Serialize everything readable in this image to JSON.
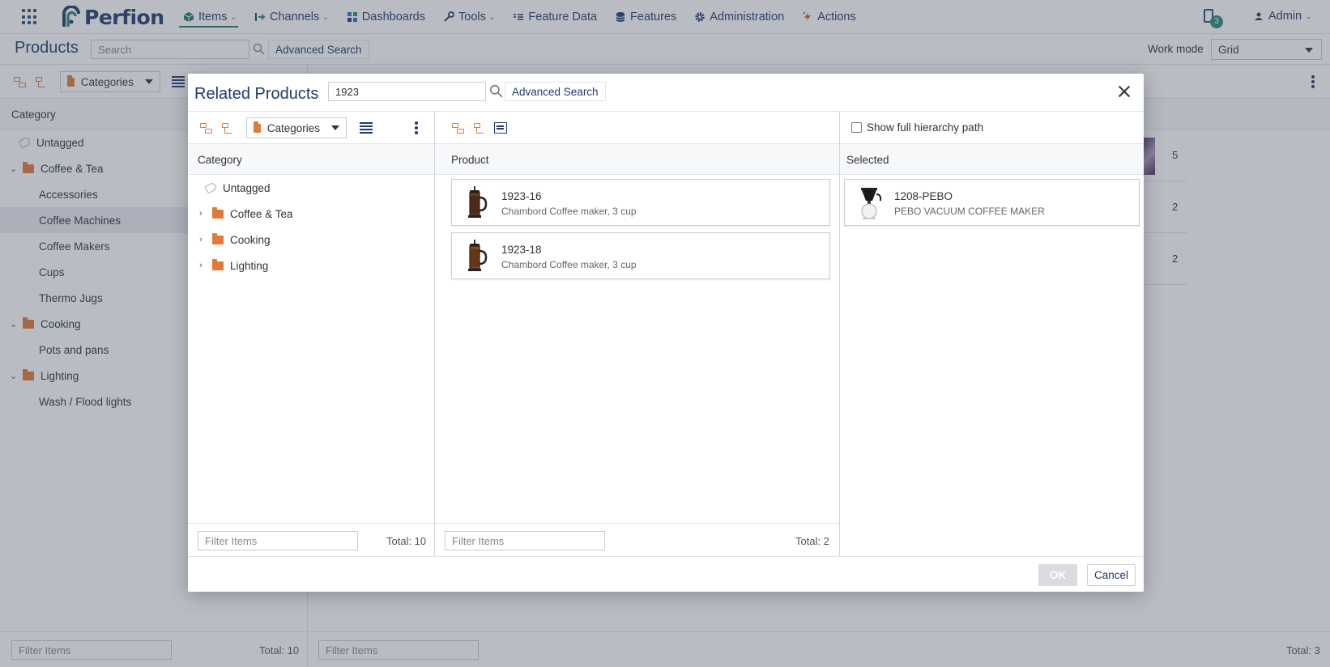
{
  "nav": {
    "logo_text": "Perfion",
    "items": [
      {
        "label": "Items",
        "active": true,
        "has_caret": true,
        "icon": "cube-icon",
        "color": "#1f7a6e"
      },
      {
        "label": "Channels",
        "has_caret": true,
        "icon": "channel-arrow-icon",
        "color": "#1f3a6e"
      },
      {
        "label": "Dashboards",
        "has_caret": false,
        "icon": "dashboard-grid-icon",
        "color": "#2c6ec7"
      },
      {
        "label": "Tools",
        "has_caret": true,
        "icon": "wrench-icon",
        "color": "#1f3a6e"
      },
      {
        "label": "Feature Data",
        "has_caret": false,
        "icon": "list-lines-icon",
        "color": "#1f3a6e"
      },
      {
        "label": "Features",
        "has_caret": false,
        "icon": "database-icon",
        "color": "#1f3a6e"
      },
      {
        "label": "Administration",
        "has_caret": false,
        "icon": "gear-icon",
        "color": "#1f3a6e"
      },
      {
        "label": "Actions",
        "has_caret": false,
        "icon": "lightning-icon",
        "color": "#e0522e"
      }
    ],
    "notification_count": "3",
    "user_label": "Admin"
  },
  "page": {
    "title": "Products",
    "search_placeholder": "Search",
    "advanced_search": "Advanced Search",
    "work_mode_label": "Work mode",
    "work_mode_value": "Grid",
    "categories_dropdown": "Categories",
    "category_header": "Category",
    "tree": [
      {
        "label": "Untagged",
        "level": 0,
        "type": "tag"
      },
      {
        "label": "Coffee & Tea",
        "level": 0,
        "type": "folder",
        "expanded": true
      },
      {
        "label": "Accessories",
        "level": 1
      },
      {
        "label": "Coffee Machines",
        "level": 1,
        "selected": true
      },
      {
        "label": "Coffee Makers",
        "level": 1
      },
      {
        "label": "Cups",
        "level": 1
      },
      {
        "label": "Thermo Jugs",
        "level": 1
      },
      {
        "label": "Cooking",
        "level": 0,
        "type": "folder",
        "expanded": true
      },
      {
        "label": "Pots and pans",
        "level": 1
      },
      {
        "label": "Lighting",
        "level": 0,
        "type": "folder",
        "expanded": true
      },
      {
        "label": "Wash / Flood lights",
        "level": 1
      }
    ],
    "grid_values": [
      "5",
      "2",
      "2"
    ],
    "left_filter_placeholder": "Filter Items",
    "left_total": "Total: 10",
    "right_filter_placeholder": "Filter Items",
    "right_total": "Total: 3"
  },
  "dialog": {
    "title": "Related Products",
    "search_value": "1923",
    "advanced_search": "Advanced Search",
    "categories_dropdown": "Categories",
    "category_header": "Category",
    "category_tree": [
      {
        "label": "Untagged",
        "type": "tag"
      },
      {
        "label": "Coffee & Tea",
        "type": "folder"
      },
      {
        "label": "Cooking",
        "type": "folder"
      },
      {
        "label": "Lighting",
        "type": "folder"
      }
    ],
    "category_filter_placeholder": "Filter Items",
    "category_total": "Total: 10",
    "product_header": "Product",
    "products": [
      {
        "sku": "1923-16",
        "desc": "Chambord Coffee maker, 3 cup"
      },
      {
        "sku": "1923-18",
        "desc": "Chambord Coffee maker, 3 cup"
      }
    ],
    "product_filter_placeholder": "Filter Items",
    "product_total": "Total: 2",
    "show_hierarchy_label": "Show full hierarchy path",
    "selected_header": "Selected",
    "selected": [
      {
        "sku": "1208-PEBO",
        "desc": "PEBO VACUUM COFFEE MAKER"
      }
    ],
    "ok_label": "OK",
    "cancel_label": "Cancel"
  }
}
